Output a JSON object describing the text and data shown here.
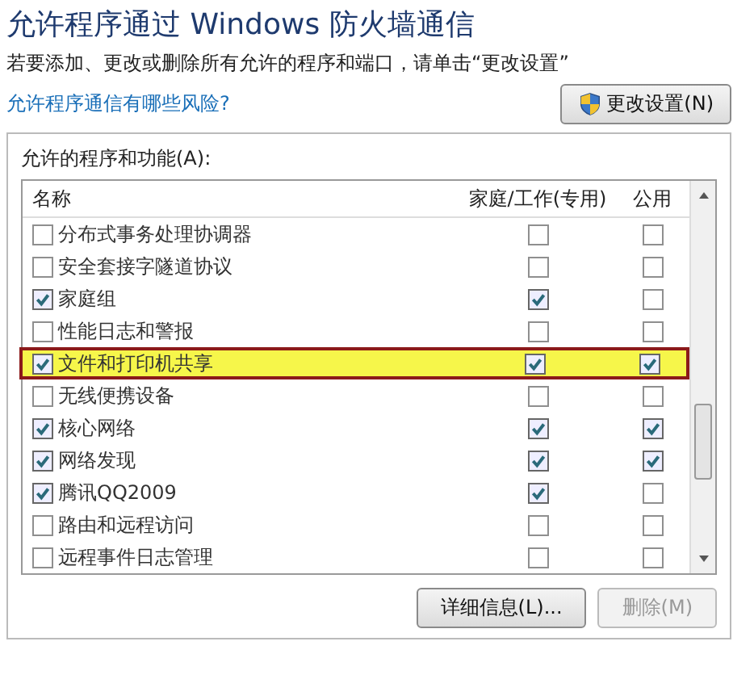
{
  "title": "允许程序通过 Windows 防火墙通信",
  "subtitle": "若要添加、更改或删除所有允许的程序和端口，请单击“更改设置”",
  "risk_link": "允许程序通信有哪些风险?",
  "change_settings_button": {
    "label": "更改设置(N)"
  },
  "group": {
    "label": "允许的程序和功能(A):",
    "columns": [
      "名称",
      "家庭/工作(专用)",
      "公用"
    ],
    "rows": [
      {
        "name": "分布式事务处理协调器",
        "enabled": false,
        "home": false,
        "public": false,
        "highlighted": false
      },
      {
        "name": "安全套接字隧道协议",
        "enabled": false,
        "home": false,
        "public": false,
        "highlighted": false
      },
      {
        "name": "家庭组",
        "enabled": true,
        "home": true,
        "public": false,
        "highlighted": false
      },
      {
        "name": "性能日志和警报",
        "enabled": false,
        "home": false,
        "public": false,
        "highlighted": false
      },
      {
        "name": "文件和打印机共享",
        "enabled": true,
        "home": true,
        "public": true,
        "highlighted": true
      },
      {
        "name": "无线便携设备",
        "enabled": false,
        "home": false,
        "public": false,
        "highlighted": false
      },
      {
        "name": "核心网络",
        "enabled": true,
        "home": true,
        "public": true,
        "highlighted": false
      },
      {
        "name": "网络发现",
        "enabled": true,
        "home": true,
        "public": true,
        "highlighted": false
      },
      {
        "name": "腾讯QQ2009",
        "enabled": true,
        "home": true,
        "public": false,
        "highlighted": false
      },
      {
        "name": "路由和远程访问",
        "enabled": false,
        "home": false,
        "public": false,
        "highlighted": false
      },
      {
        "name": "远程事件日志管理",
        "enabled": false,
        "home": false,
        "public": false,
        "highlighted": false
      }
    ],
    "buttons": [
      {
        "label": "详细信息(L)...",
        "disabled": false
      },
      {
        "label": "删除(M)",
        "disabled": true
      }
    ]
  }
}
